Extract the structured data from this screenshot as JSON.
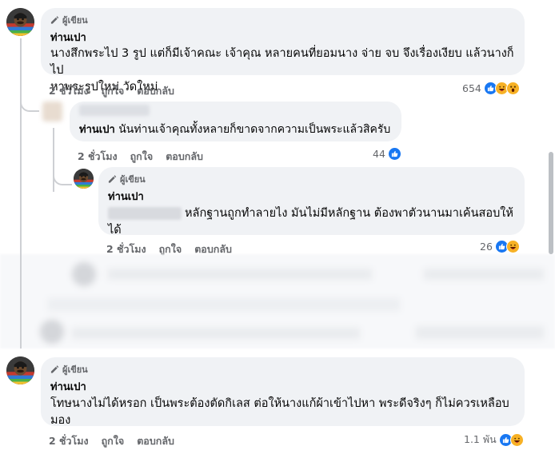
{
  "comments": [
    {
      "badge": "ผู้เขียน",
      "name": "ท่านเปา",
      "text_line1": "นางสึกพระไป 3 รูป แต่ก็มีเจ้าคณะ เจ้าคุณ หลายคนที่ยอมนาง จ่าย จบ จึงเรื่องเงียบ แล้วนางก็ไป",
      "text_line2": "หาพระรูปใหม่ วัดใหม่",
      "time": "2 ชั่วโมง",
      "like": "ถูกใจ",
      "reply": "ตอบกลับ",
      "reaction_count": "654"
    },
    {
      "name": "ท่านเปา",
      "text": "นันท่านเจ้าคุณทั้งหลายก็ขาดจากความเป็นพระแล้วสิครับ",
      "time": "2 ชั่วโมง",
      "like": "ถูกใจ",
      "reply": "ตอบกลับ",
      "reaction_count": "44"
    },
    {
      "badge": "ผู้เขียน",
      "name": "ท่านเปา",
      "text_line1": "หลักฐานถูกทำลายไง มันไม่มีหลักฐาน ต้องพาตัวนานมาเค้นสอบให้",
      "text_line2": "ได้",
      "time": "2 ชั่วโมง",
      "like": "ถูกใจ",
      "reply": "ตอบกลับ",
      "reaction_count": "26"
    },
    {
      "badge": "ผู้เขียน",
      "name": "ท่านเปา",
      "text_line1": "โทษนางไม่ได้หรอก เป็นพระต้องตัดกิเลส ต่อให้นางแก้ผ้าเข้าไปหา พระดีจริงๆ ก็ไม่ควรเหลือบ",
      "text_line2": "มอง",
      "time": "2 ชั่วโมง",
      "like": "ถูกใจ",
      "reply": "ตอบกลับ",
      "reaction_count": "1.1 พัน"
    }
  ],
  "colors": {
    "bubble": "#f0f2f5",
    "like_blue": "#1877f2",
    "haha_yellow": "#f7b125",
    "meta_gray": "#65676b"
  },
  "icons": {
    "badge": "pencil-icon",
    "like": "thumbs-up-icon",
    "haha": "haha-emoji-icon",
    "wow": "wow-emoji-icon"
  }
}
